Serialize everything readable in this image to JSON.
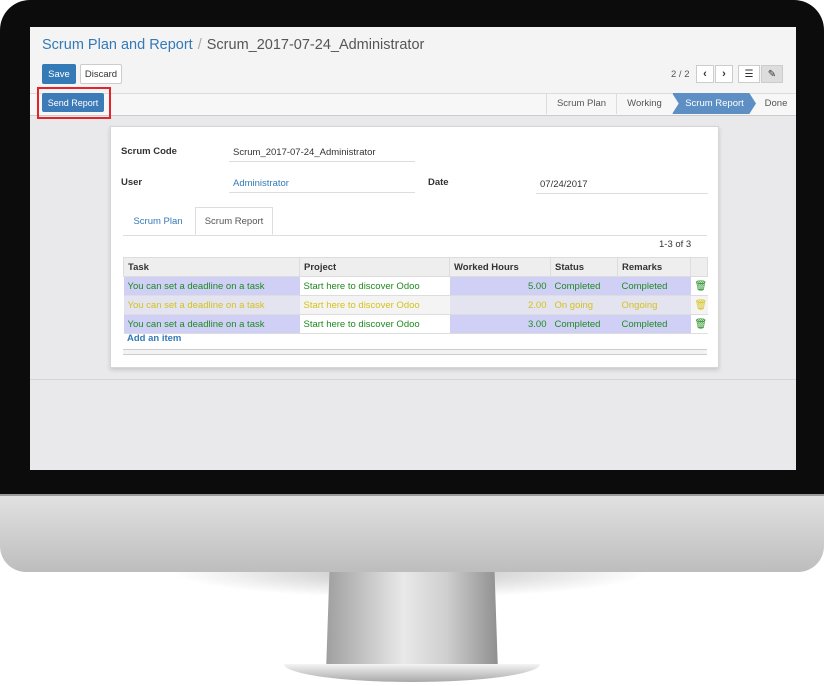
{
  "breadcrumb": {
    "parent": "Scrum Plan and Report",
    "separator": "/",
    "current": "Scrum_2017-07-24_Administrator"
  },
  "toolbar": {
    "save_label": "Save",
    "discard_label": "Discard",
    "pager": "2 / 2"
  },
  "statusbar": {
    "send_report_label": "Send Report",
    "stages": [
      "Scrum Plan",
      "Working",
      "Scrum Report",
      "Done"
    ],
    "active_stage": "Scrum Report"
  },
  "form": {
    "scrum_code_label": "Scrum Code",
    "scrum_code_value": "Scrum_2017-07-24_Administrator",
    "user_label": "User",
    "user_value": "Administrator",
    "date_label": "Date",
    "date_value": "07/24/2017"
  },
  "tabs": [
    "Scrum Plan",
    "Scrum Report"
  ],
  "active_tab": "Scrum Report",
  "report": {
    "count": "1-3 of 3",
    "columns": [
      "Task",
      "Project",
      "Worked Hours",
      "Status",
      "Remarks"
    ],
    "rows": [
      {
        "task": "You can set a deadline on a task",
        "project": "Start here to discover Odoo",
        "hours": "5.00",
        "status": "Completed",
        "remarks": "Completed",
        "color": "#1e8a1e"
      },
      {
        "task": "You can set a deadline on a task",
        "project": "Start here to discover Odoo",
        "hours": "2.00",
        "status": "On going",
        "remarks": "Ongoing",
        "color": "#d4c21a"
      },
      {
        "task": "You can set a deadline on a task",
        "project": "Start here to discover Odoo",
        "hours": "3.00",
        "status": "Completed",
        "remarks": "Completed",
        "color": "#1e8a1e"
      }
    ],
    "add_item_label": "Add an item"
  },
  "icons": {
    "prev": "chevron-left-icon",
    "next": "chevron-right-icon",
    "list_view": "list-icon",
    "form_view": "edit-icon",
    "delete": "trash-icon"
  },
  "colors": {
    "primary": "#337ab7",
    "highlight": "#d0d0f7",
    "completed": "#1e8a1e",
    "ongoing": "#d4c21a",
    "annotation": "#e4232b"
  }
}
